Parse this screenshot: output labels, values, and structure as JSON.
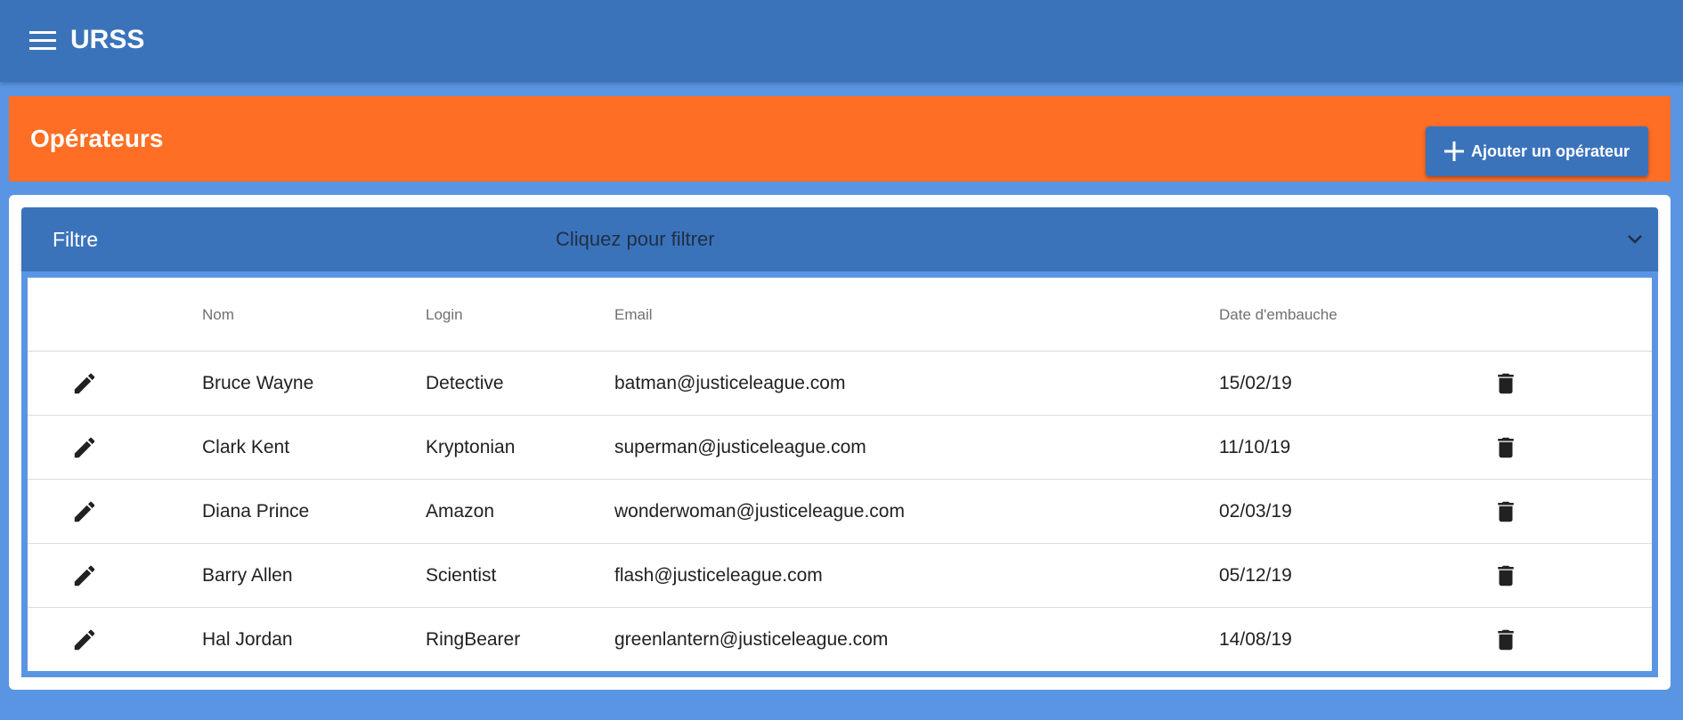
{
  "app": {
    "title": "URSS",
    "menu_icon": "menu-icon"
  },
  "page": {
    "title": "Opérateurs",
    "add_button_label": "Ajouter un opérateur",
    "add_icon": "plus-icon"
  },
  "filter": {
    "label": "Filtre",
    "hint": "Cliquez pour filtrer",
    "toggle_icon": "chevron-down-icon"
  },
  "table": {
    "columns": [
      "",
      "Nom",
      "Login",
      "Email",
      "Date d'embauche",
      ""
    ],
    "rows": [
      {
        "nom": "Bruce Wayne",
        "login": "Detective",
        "email": "batman@justiceleague.com",
        "date": "15/02/19"
      },
      {
        "nom": "Clark Kent",
        "login": "Kryptonian",
        "email": "superman@justiceleague.com",
        "date": "11/10/19"
      },
      {
        "nom": "Diana Prince",
        "login": "Amazon",
        "email": "wonderwoman@justiceleague.com",
        "date": "02/03/19"
      },
      {
        "nom": "Barry Allen",
        "login": "Scientist",
        "email": "flash@justiceleague.com",
        "date": "05/12/19"
      },
      {
        "nom": "Hal Jordan",
        "login": "RingBearer",
        "email": "greenlantern@justiceleague.com",
        "date": "14/08/19"
      }
    ],
    "edit_icon": "pencil-icon",
    "delete_icon": "trash-icon"
  },
  "colors": {
    "primary": "#3b73bb",
    "accent": "#ff6e24",
    "background": "#5a95e3"
  }
}
